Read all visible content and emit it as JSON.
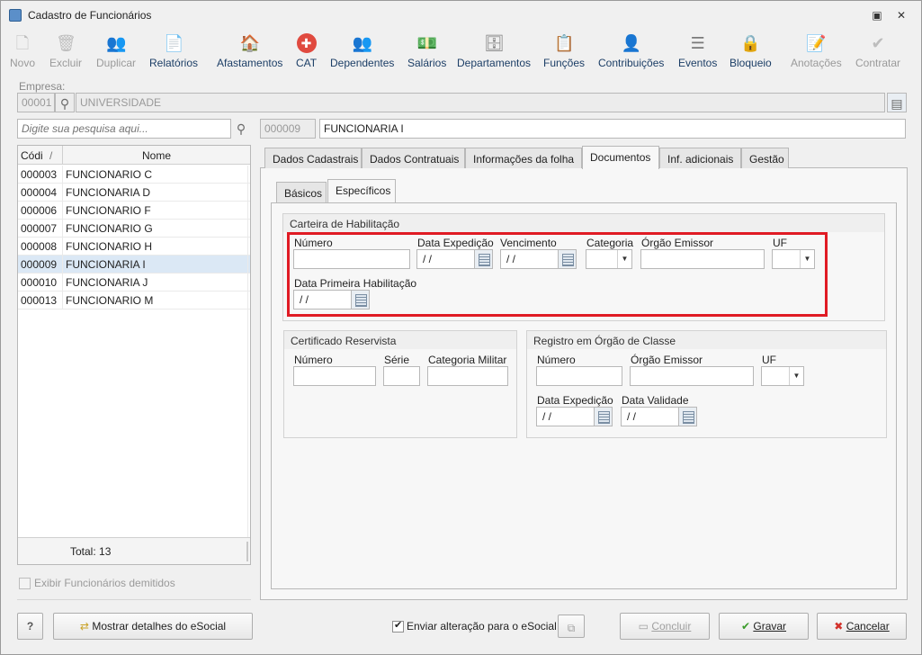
{
  "window": {
    "title": "Cadastro de Funcionários",
    "restore_glyph": "▣",
    "close_glyph": "✕"
  },
  "toolbar": [
    {
      "label": "Novo",
      "icon": "new-document-icon",
      "glyph": "🗋",
      "enabled": false
    },
    {
      "label": "Excluir",
      "icon": "trash-icon",
      "glyph": "🗑",
      "enabled": false
    },
    {
      "label": "Duplicar",
      "icon": "users-icon",
      "glyph": "👥",
      "enabled": false
    },
    {
      "label": "Relatórios",
      "icon": "report-icon",
      "glyph": "📄",
      "enabled": true
    },
    {
      "label": "Afastamentos",
      "icon": "house-icon",
      "glyph": "🏠",
      "enabled": true
    },
    {
      "label": "CAT",
      "icon": "red-cross-icon",
      "glyph": "✚",
      "enabled": true
    },
    {
      "label": "Dependentes",
      "icon": "people-icon",
      "glyph": "👥",
      "enabled": true
    },
    {
      "label": "Salários",
      "icon": "money-icon",
      "glyph": "💵",
      "enabled": true
    },
    {
      "label": "Departamentos",
      "icon": "desk-icon",
      "glyph": "🗄",
      "enabled": true
    },
    {
      "label": "Funções",
      "icon": "clipboard-icon",
      "glyph": "📋",
      "enabled": true
    },
    {
      "label": "Contribuições",
      "icon": "people-group-icon",
      "glyph": "👤",
      "enabled": true
    },
    {
      "label": "Eventos",
      "icon": "list-icon",
      "glyph": "☰",
      "enabled": true
    },
    {
      "label": "Bloqueio",
      "icon": "lock-icon",
      "glyph": "🔒",
      "enabled": true
    },
    {
      "label": "Anotações",
      "icon": "note-icon",
      "glyph": "📝",
      "enabled": false
    },
    {
      "label": "Contratar",
      "icon": "hire-icon",
      "glyph": "✔",
      "enabled": false
    }
  ],
  "empresa": {
    "label": "Empresa:",
    "code": "00001",
    "name": "UNIVERSIDADE"
  },
  "search": {
    "placeholder": "Digite sua pesquisa aqui..."
  },
  "employee": {
    "code": "000009",
    "name": "FUNCIONARIA I"
  },
  "list": {
    "col_code": "Códi",
    "col_sort": "/",
    "col_name": "Nome",
    "rows": [
      {
        "code": "000003",
        "name": "FUNCIONARIO C"
      },
      {
        "code": "000004",
        "name": "FUNCIONARIA D"
      },
      {
        "code": "000006",
        "name": "FUNCIONARIO F"
      },
      {
        "code": "000007",
        "name": "FUNCIONARIO G"
      },
      {
        "code": "000008",
        "name": "FUNCIONARIO H"
      },
      {
        "code": "000009",
        "name": "FUNCIONARIA I"
      },
      {
        "code": "000010",
        "name": "FUNCIONARIA J"
      },
      {
        "code": "000013",
        "name": "FUNCIONARIO M"
      }
    ],
    "selected_code": "000009",
    "total": "Total: 13"
  },
  "show_dismissed": "Exibir Funcionários demitidos",
  "tabs": [
    "Dados Cadastrais",
    "Dados Contratuais",
    "Informações da folha",
    "Documentos",
    "Inf. adicionais",
    "Gestão"
  ],
  "active_tab": "Documentos",
  "subtabs": [
    "Básicos",
    "Específicos"
  ],
  "active_subtab": "Específicos",
  "cnh": {
    "title": "Carteira de Habilitação",
    "numero": "Número",
    "data_expedicao": "Data Expedição",
    "vencimento": "Vencimento",
    "categoria": "Categoria",
    "orgao_emissor": "Órgão Emissor",
    "uf": "UF",
    "data_primeira": "Data Primeira Habilitação",
    "date_empty": " /  /"
  },
  "reservista": {
    "title": "Certificado Reservista",
    "numero": "Número",
    "serie": "Série",
    "categoria_militar": "Categoria Militar"
  },
  "orgao_classe": {
    "title": "Registro em Órgão de Classe",
    "numero": "Número",
    "orgao_emissor": "Órgão Emissor",
    "uf": "UF",
    "data_expedicao": "Data Expedição",
    "data_validade": "Data Validade"
  },
  "bottom": {
    "help": "?",
    "esocial_details": "Mostrar detalhes do eSocial",
    "send_esocial": "Enviar alteração para o eSocial",
    "concluir": "Concluir",
    "gravar": "Gravar",
    "cancelar": "Cancelar"
  }
}
